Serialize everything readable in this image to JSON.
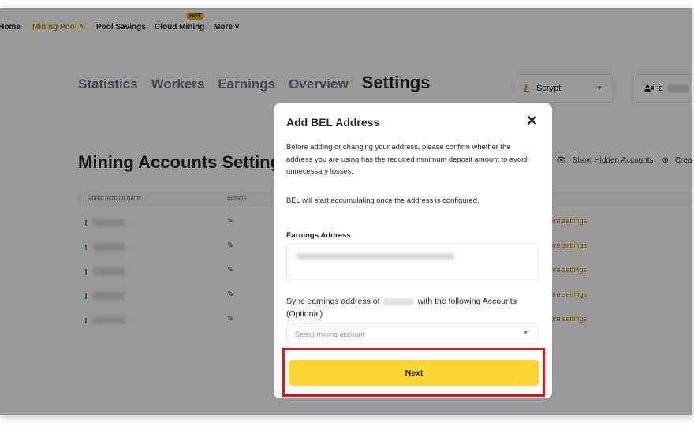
{
  "nav": {
    "items": [
      "Home",
      "Mining Pool ˄",
      "Pool Savings",
      "Cloud Mining",
      "More ˅"
    ],
    "hot_badge": "HOT"
  },
  "tabs": [
    "Statistics",
    "Workers",
    "Earnings",
    "Overview",
    "Settings"
  ],
  "algorithm": {
    "logo": "Ł",
    "value": "Scrypt",
    "caret": "▼"
  },
  "user": {
    "initial": "c"
  },
  "section": {
    "title": "Mining Accounts Settings",
    "show_hidden": "Show Hidden Accounts",
    "create": "Create"
  },
  "table": {
    "headers": [
      "Mining Account Name",
      "Remark"
    ],
    "row_more_label": "More settings",
    "row_count": 5
  },
  "modal": {
    "title": "Add BEL Address",
    "close": "✕",
    "description": "Before adding or changing your address, please confirm whether the address you are using has the required minimum deposit amount to avoid unnecessary losses.",
    "note": "BEL will start accumulating once the address is configured.",
    "earnings_label": "Earnings Address",
    "sync_prefix": "Sync earnings address of",
    "sync_suffix": "with the following Accounts (Optional)",
    "select_placeholder": "Select mining account",
    "next_label": "Next"
  }
}
